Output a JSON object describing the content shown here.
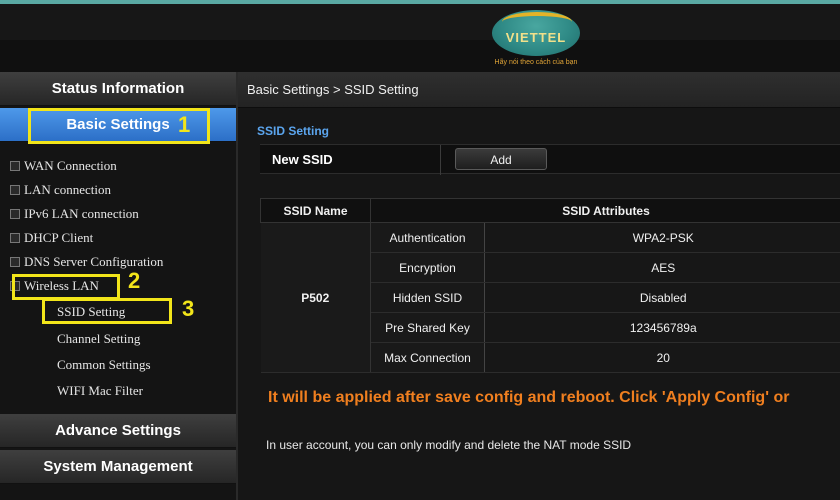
{
  "header": {
    "logo_text": "VIETTEL",
    "slogan": "Hãy nói theo cách của bạn"
  },
  "sidebar": {
    "status_information": "Status Information",
    "basic_settings": "Basic Settings",
    "items": [
      {
        "label": "WAN Connection"
      },
      {
        "label": "LAN connection"
      },
      {
        "label": "IPv6 LAN connection"
      },
      {
        "label": "DHCP Client"
      },
      {
        "label": "DNS Server Configuration"
      },
      {
        "label": "Wireless LAN"
      }
    ],
    "wireless_sub": [
      {
        "label": "SSID Setting"
      },
      {
        "label": "Channel Setting"
      },
      {
        "label": "Common Settings"
      },
      {
        "label": "WIFI Mac Filter"
      }
    ],
    "advance_settings": "Advance Settings",
    "system_management": "System Management"
  },
  "annotations": {
    "step1": "1",
    "step2": "2",
    "step3": "3",
    "highlight_color": "#f2e51a"
  },
  "main": {
    "breadcrumb": "Basic Settings > SSID Setting",
    "section_title": "SSID Setting",
    "new_ssid_label": "New SSID",
    "add_button": "Add",
    "table": {
      "headers": [
        "SSID Name",
        "SSID Attributes"
      ],
      "ssid_name": "P502",
      "rows": [
        {
          "attribute": "Authentication",
          "value": "WPA2-PSK"
        },
        {
          "attribute": "Encryption",
          "value": "AES"
        },
        {
          "attribute": "Hidden SSID",
          "value": "Disabled"
        },
        {
          "attribute": "Pre Shared Key",
          "value": "123456789a"
        },
        {
          "attribute": "Max Connection",
          "value": "20"
        }
      ]
    },
    "warning": "It will be applied after save config and reboot. Click 'Apply Config' or",
    "note": "In user account, you can only modify and delete the NAT mode SSID"
  },
  "colors": {
    "accent_blue": "#2c6fc7",
    "section_title": "#5ba5ee",
    "warning": "#f07f1f"
  }
}
